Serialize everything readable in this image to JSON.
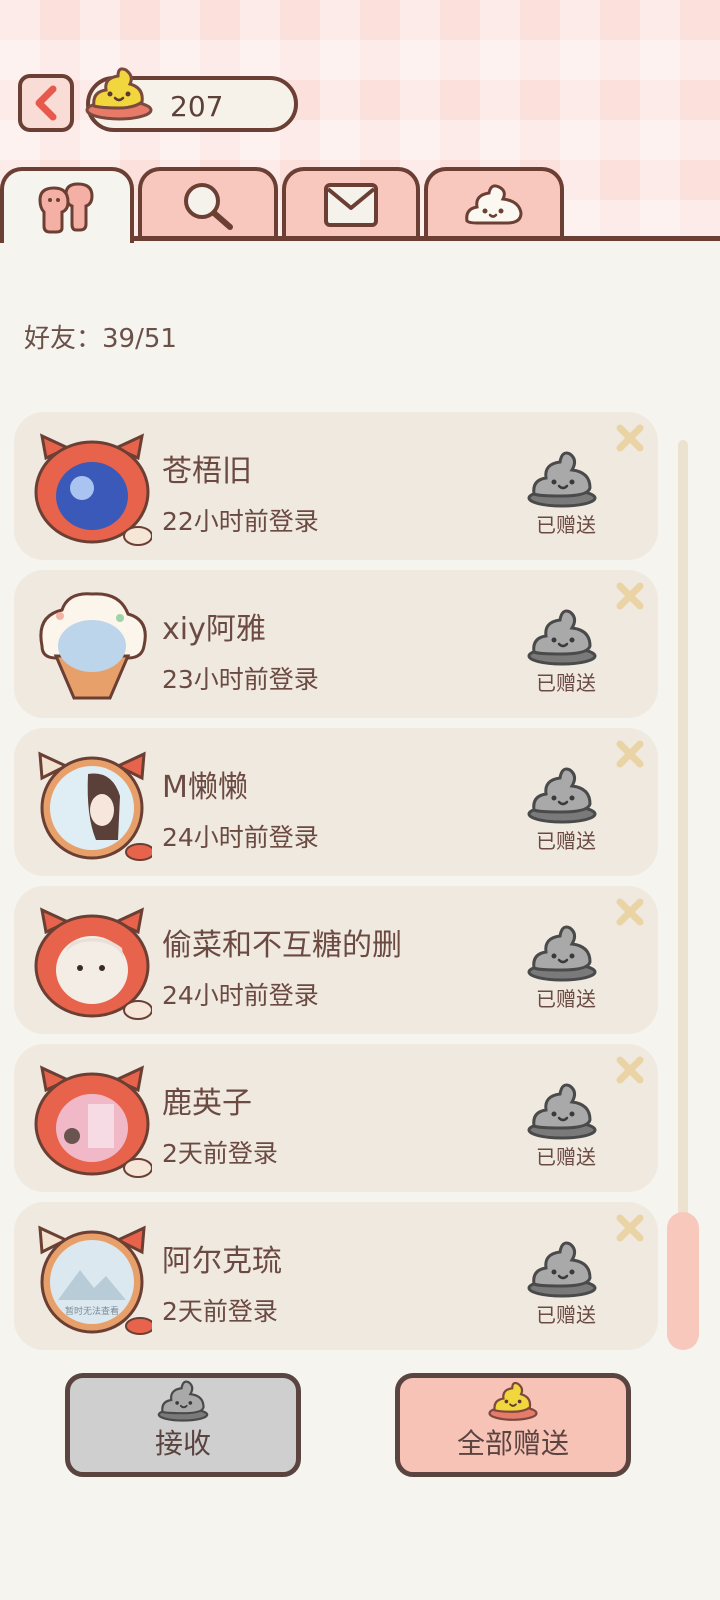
{
  "header": {
    "back_icon": "chevron-left-icon",
    "currency_icon": "yellow-poop-icon",
    "currency_value": "207"
  },
  "tabs": [
    {
      "icon": "friends-icon",
      "active": true
    },
    {
      "icon": "search-icon",
      "active": false
    },
    {
      "icon": "mail-icon",
      "active": false
    },
    {
      "icon": "white-poop-icon",
      "active": false
    }
  ],
  "friends": {
    "count_label": "好友：39/51",
    "items": [
      {
        "name": "苍梧旧",
        "login": "22小时前登录",
        "status": "已赠送"
      },
      {
        "name": "xiy阿雅",
        "login": "23小时前登录",
        "status": "已赠送"
      },
      {
        "name": "M懒懒",
        "login": "24小时前登录",
        "status": "已赠送"
      },
      {
        "name": "偷菜和不互糖的删",
        "login": "24小时前登录",
        "status": "已赠送"
      },
      {
        "name": "鹿英子",
        "login": "2天前登录",
        "status": "已赠送"
      },
      {
        "name": "阿尔克琉",
        "login": "2天前登录",
        "status": "已赠送",
        "avatar_caption": "暂时无法查看"
      }
    ]
  },
  "actions": {
    "receive_label": "接收",
    "gift_all_label": "全部赠送"
  },
  "colors": {
    "accent": "#f8c3b7",
    "outline": "#6b3f33",
    "row_bg": "#efe9df",
    "panda_red": "#e8634b"
  }
}
